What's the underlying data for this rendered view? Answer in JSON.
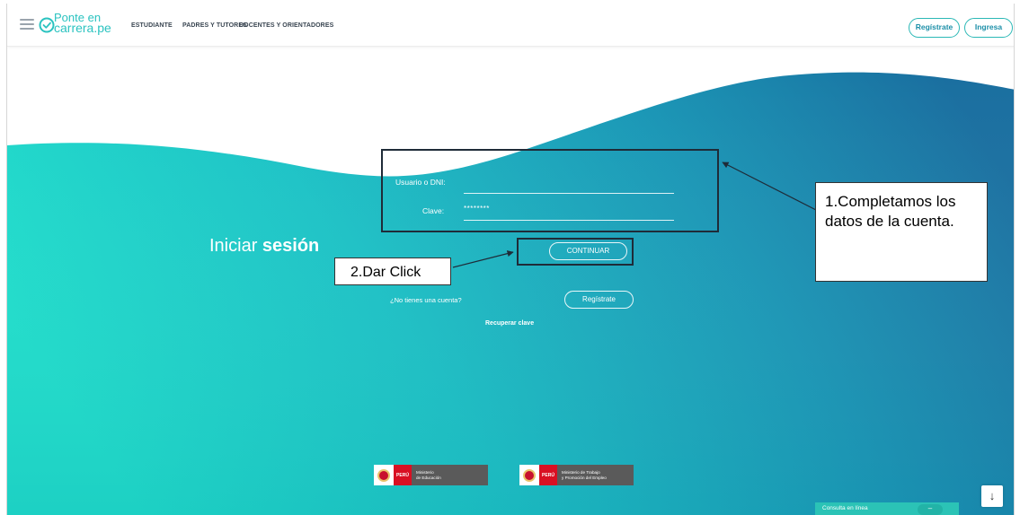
{
  "navbar": {
    "logo_line_1": "Ponte en",
    "logo_line_2": "carrera.pe",
    "links": [
      "ESTUDIANTE",
      "PADRES Y TUTORES",
      "DOCENTES Y ORIENTADORES"
    ],
    "register_label": "Regístrate",
    "login_label": "Ingresa"
  },
  "login": {
    "title_light": "Iniciar ",
    "title_bold": "sesión",
    "user_label": "Usuario o DNI:",
    "user_value": "",
    "password_label": "Clave:",
    "password_value": "********",
    "continue_label": "CONTINUAR",
    "no_account_text": "¿No tienes una cuenta?",
    "register_label": "Regístrate",
    "recover_label": "Recuperar clave"
  },
  "ministries": [
    {
      "country": "PERÚ",
      "name": "Ministerio de Educación",
      "name_l1": "Ministerio",
      "name_l2": "de Educación"
    },
    {
      "country": "PERÚ",
      "name": "Ministerio de Trabajo y Promoción del Empleo",
      "name_l1": "Ministerio de Trabajo",
      "name_l2": "y Promoción del Empleo"
    }
  ],
  "chat": {
    "label": "Consulta en línea",
    "minimize": "–"
  },
  "scroll_down_icon": "↓",
  "annotations": {
    "callout_1": "1.Completamos los datos de la cuenta.",
    "callout_2": "2.Dar Click"
  },
  "colors": {
    "brand_teal": "#2bc3c0",
    "hero_gradient_start": "#1fd6c8",
    "hero_gradient_end": "#1a6fa0",
    "annotation_border": "#1f2b38"
  }
}
